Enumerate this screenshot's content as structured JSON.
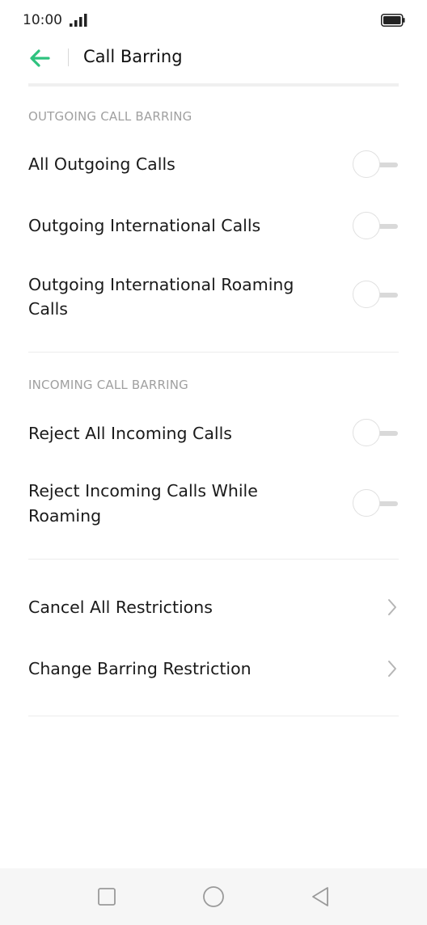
{
  "status_bar": {
    "time": "10:00",
    "signal_icon": "signal-bars-icon",
    "battery_icon": "battery-full-icon"
  },
  "header": {
    "back_icon": "arrow-left-icon",
    "title": "Call Barring",
    "accent_color": "#2ec27e"
  },
  "sections": {
    "outgoing": {
      "header": "OUTGOING CALL BARRING",
      "items": [
        {
          "label": "All Outgoing Calls",
          "enabled": false
        },
        {
          "label": "Outgoing International Calls",
          "enabled": false
        },
        {
          "label_line1": "Outgoing International Roaming",
          "label_line2": "Calls",
          "enabled": false
        }
      ]
    },
    "incoming": {
      "header": "INCOMING CALL BARRING",
      "items": [
        {
          "label": "Reject All Incoming Calls",
          "enabled": false
        },
        {
          "label_line1": "Reject Incoming Calls While",
          "label_line2": "Roaming",
          "enabled": false
        }
      ]
    },
    "restrictions": {
      "items": [
        {
          "label": "Cancel All Restrictions",
          "icon": "chevron-right-icon"
        },
        {
          "label": "Change Barring Restriction",
          "icon": "chevron-right-icon"
        }
      ]
    }
  },
  "nav_bar": {
    "recents_icon": "square-icon",
    "home_icon": "circle-icon",
    "back_icon": "triangle-back-icon"
  }
}
